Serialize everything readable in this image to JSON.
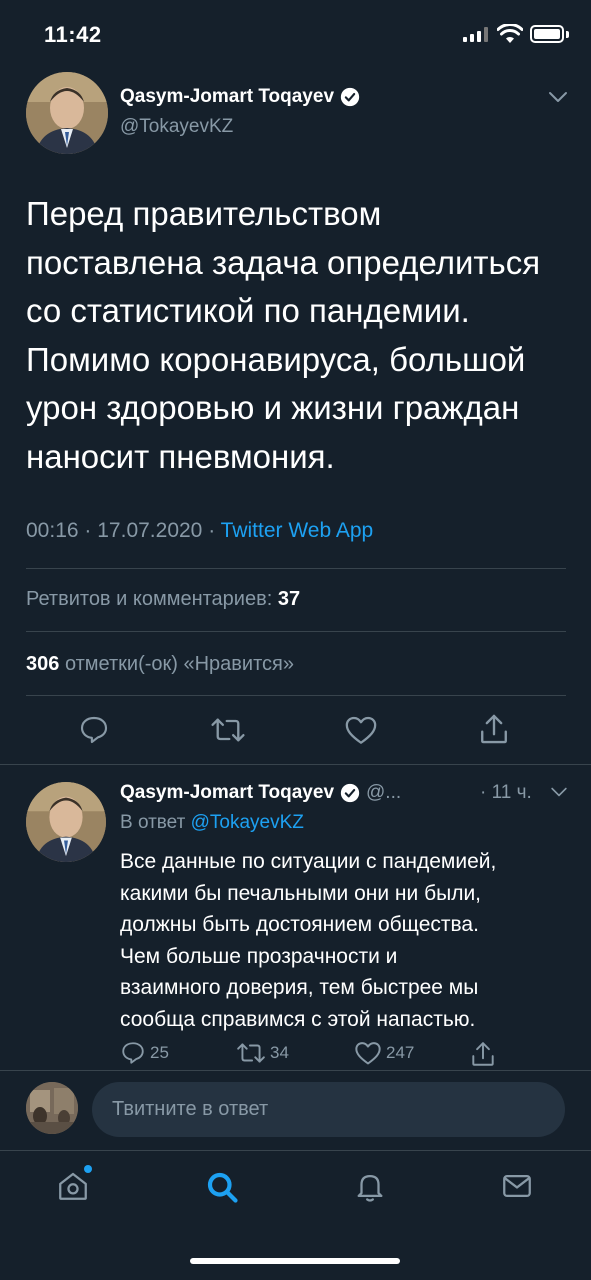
{
  "status_bar": {
    "time": "11:42"
  },
  "main_tweet": {
    "author_name": "Qasym-Jomart Toqayev",
    "handle": "@TokayevKZ",
    "text": "Перед правительством\nпоставлена задача определиться\nсо статистикой по пандемии.\nПомимо коронавируса, большой\nурон здоровью и жизни граждан\nнаносит пневмония.",
    "time": "00:16",
    "date": "17.07.2020",
    "separator": "·",
    "source": "Twitter Web App",
    "retweets_label": "Ретвитов и комментариев:",
    "retweets_count": "37",
    "likes_count": "306",
    "likes_label": "отметки(-ок) «Нравится»"
  },
  "reply_tweet": {
    "author_name": "Qasym-Jomart Toqayev",
    "handle_truncated": "@...",
    "time_ago": "· 11 ч.",
    "reply_to_label": "В ответ",
    "reply_to_handle": "@TokayevKZ",
    "text": "Все данные по ситуации с пандемией,\nкакими бы печальными они ни были,\nдолжны  быть достоянием общества.\nЧем больше прозрачности и\nвзаимного доверия, тем быстрее мы\nсообща справимся с этой напастью.",
    "replies": "25",
    "retweets": "34",
    "likes": "247"
  },
  "composer": {
    "placeholder": "Твитните в ответ"
  },
  "colors": {
    "background": "#15202b",
    "accent": "#1da1f2",
    "muted": "#8899a6",
    "divider": "#38444d"
  },
  "icons": [
    "chevron-down-icon",
    "verified-icon",
    "reply-icon",
    "retweet-icon",
    "like-icon",
    "share-icon",
    "home-icon",
    "search-icon",
    "notifications-icon",
    "messages-icon"
  ]
}
